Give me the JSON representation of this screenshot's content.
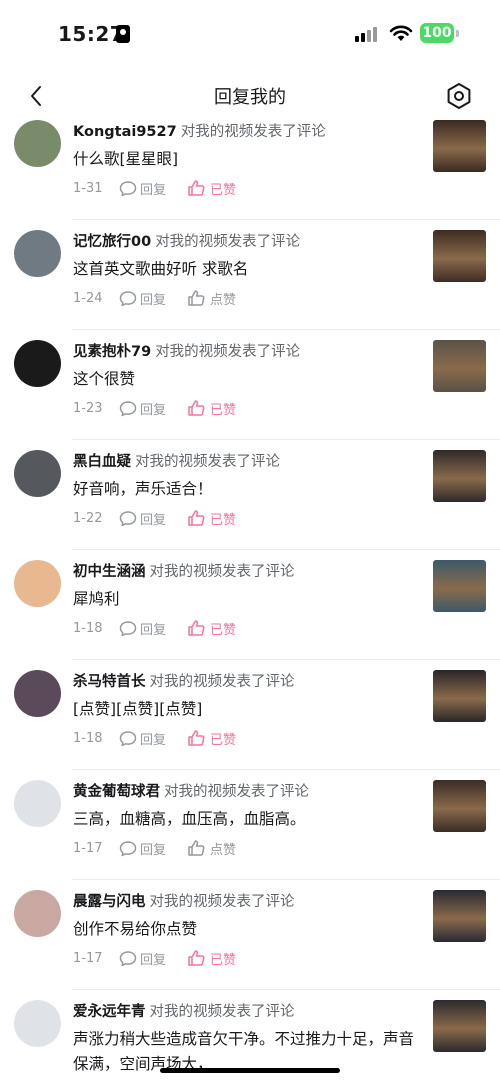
{
  "status_bar": {
    "time": "15:27",
    "battery": "100"
  },
  "nav": {
    "title": "回复我的"
  },
  "colors": {
    "accent_pink": "#fb7299",
    "meta_gray": "#9499a0",
    "battery_green": "#4cd964"
  },
  "items": [
    {
      "username": "Kongtai9527",
      "action": "对我的视频发表了评论",
      "comment": "什么歌[星星眼]",
      "date": "1-31",
      "reply_label": "回复",
      "like_label": "已赞",
      "liked": true,
      "avatar_color": "#7a8b6a",
      "thumb_color": "#3a2a22"
    },
    {
      "username": "记忆旅行00",
      "action": "对我的视频发表了评论",
      "comment": "这首英文歌曲好听 求歌名",
      "date": "1-24",
      "reply_label": "回复",
      "like_label": "点赞",
      "liked": false,
      "avatar_color": "#6f7a82",
      "thumb_color": "#3e2c22"
    },
    {
      "username": "见素抱朴79",
      "action": "对我的视频发表了评论",
      "comment": "这个很赞",
      "date": "1-23",
      "reply_label": "回复",
      "like_label": "已赞",
      "liked": true,
      "avatar_color": "#1a1a1a",
      "thumb_color": "#5a5248"
    },
    {
      "username": "黑白血疑",
      "action": "对我的视频发表了评论",
      "comment": "好音响，声乐适合！",
      "date": "1-22",
      "reply_label": "回复",
      "like_label": "已赞",
      "liked": true,
      "avatar_color": "#55585c",
      "thumb_color": "#2e2a2a"
    },
    {
      "username": "初中生涵涵",
      "action": "对我的视频发表了评论",
      "comment": "犀鸠利",
      "date": "1-18",
      "reply_label": "回复",
      "like_label": "已赞",
      "liked": true,
      "avatar_color": "#e8b890",
      "thumb_color": "#3c5a6a"
    },
    {
      "username": "杀马特首长",
      "action": "对我的视频发表了评论",
      "comment": "[点赞][点赞][点赞]",
      "date": "1-18",
      "reply_label": "回复",
      "like_label": "已赞",
      "liked": true,
      "avatar_color": "#5a4a5a",
      "thumb_color": "#2a2628"
    },
    {
      "username": "黄金葡萄球君",
      "action": "对我的视频发表了评论",
      "comment": "三高，血糖高，血压高，血脂高。",
      "date": "1-17",
      "reply_label": "回复",
      "like_label": "点赞",
      "liked": false,
      "avatar_color": "#dfe3e8",
      "thumb_color": "#3a2c26"
    },
    {
      "username": "晨露与闪电",
      "action": "对我的视频发表了评论",
      "comment": "创作不易给你点赞",
      "date": "1-17",
      "reply_label": "回复",
      "like_label": "已赞",
      "liked": true,
      "avatar_color": "#c8a8a0",
      "thumb_color": "#2a2a34"
    },
    {
      "username": "爱永远年青",
      "action": "对我的视频发表了评论",
      "comment": "声涨力稍大些造成音欠干净。不过推力十足，声音保满，空间声场大，",
      "date": "",
      "reply_label": "",
      "like_label": "",
      "liked": false,
      "avatar_color": "#dfe3e8",
      "thumb_color": "#2c2a2e"
    }
  ]
}
